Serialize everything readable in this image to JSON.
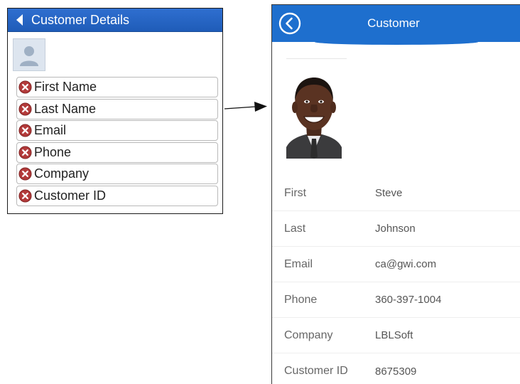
{
  "designer": {
    "header_title": "Customer Details",
    "fields": [
      {
        "label": "First Name"
      },
      {
        "label": "Last Name"
      },
      {
        "label": "Email"
      },
      {
        "label": "Phone"
      },
      {
        "label": "Company"
      },
      {
        "label": "Customer ID"
      }
    ],
    "icons": {
      "back": "back-triangle-icon",
      "avatar": "person-placeholder-icon",
      "remove": "remove-circle-icon"
    },
    "colors": {
      "header": "#2563c4",
      "remove_icon": "#b33a3a"
    }
  },
  "preview": {
    "header_title": "Customer",
    "icons": {
      "back": "back-circle-icon"
    },
    "colors": {
      "header": "#1e6fce"
    },
    "details": [
      {
        "label": "First",
        "value": "Steve"
      },
      {
        "label": "Last",
        "value": "Johnson"
      },
      {
        "label": "Email",
        "value": "ca@gwi.com"
      },
      {
        "label": "Phone",
        "value": "360-397-1004"
      },
      {
        "label": "Company",
        "value": "LBLSoft"
      },
      {
        "label": "Customer ID",
        "value": "8675309"
      }
    ]
  }
}
